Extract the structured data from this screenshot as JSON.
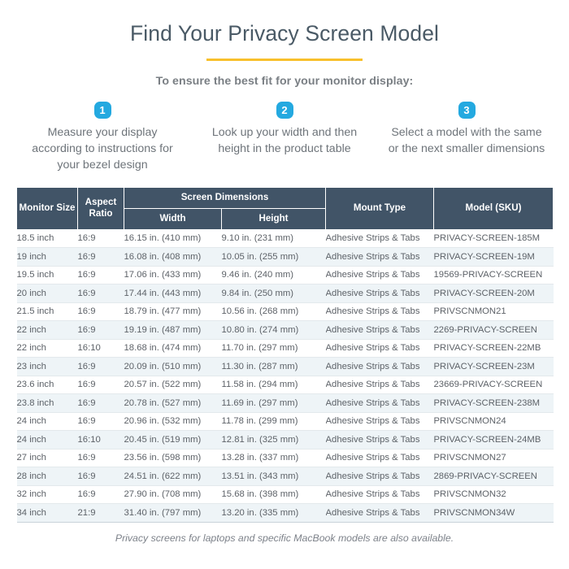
{
  "header": {
    "title": "Find Your Privacy Screen Model",
    "subtitle": "To ensure the best fit for your monitor display:",
    "accent_color": "#f8c02c",
    "title_color": "#4a5a66"
  },
  "steps": [
    {
      "number": "1",
      "text": "Measure your display according to instructions for your bezel design"
    },
    {
      "number": "2",
      "text": "Look up your width and then height in the product table"
    },
    {
      "number": "3",
      "text": "Select a model with the same or the next smaller dimensions"
    }
  ],
  "step_badge_color": "#24a9e0",
  "table": {
    "header_color": "#415467",
    "group_header": "Screen Dimensions",
    "columns": {
      "monitor_size": "Monitor Size",
      "aspect_ratio": "Aspect Ratio",
      "width": "Width",
      "height": "Height",
      "mount_type": "Mount Type",
      "model_sku": "Model (SKU)"
    },
    "rows": [
      {
        "size": "18.5 inch",
        "aspect": "16:9",
        "width": "16.15 in. (410 mm)",
        "height": "9.10 in. (231 mm)",
        "mount": "Adhesive Strips & Tabs",
        "model": "PRIVACY-SCREEN-185M"
      },
      {
        "size": "19 inch",
        "aspect": "16:9",
        "width": "16.08 in. (408 mm)",
        "height": "10.05 in. (255 mm)",
        "mount": "Adhesive Strips & Tabs",
        "model": "PRIVACY-SCREEN-19M"
      },
      {
        "size": "19.5 inch",
        "aspect": "16:9",
        "width": "17.06 in. (433 mm)",
        "height": "9.46 in. (240 mm)",
        "mount": "Adhesive Strips & Tabs",
        "model": "19569-PRIVACY-SCREEN"
      },
      {
        "size": "20 inch",
        "aspect": "16:9",
        "width": "17.44 in. (443 mm)",
        "height": "9.84 in. (250 mm)",
        "mount": "Adhesive Strips & Tabs",
        "model": "PRIVACY-SCREEN-20M"
      },
      {
        "size": "21.5 inch",
        "aspect": "16:9",
        "width": "18.79 in. (477 mm)",
        "height": "10.56 in. (268 mm)",
        "mount": "Adhesive Strips & Tabs",
        "model": "PRIVSCNMON21"
      },
      {
        "size": "22 inch",
        "aspect": "16:9",
        "width": "19.19 in. (487 mm)",
        "height": "10.80 in. (274 mm)",
        "mount": "Adhesive Strips & Tabs",
        "model": "2269-PRIVACY-SCREEN"
      },
      {
        "size": "22 inch",
        "aspect": "16:10",
        "width": "18.68 in. (474 mm)",
        "height": "11.70 in. (297 mm)",
        "mount": "Adhesive Strips & Tabs",
        "model": "PRIVACY-SCREEN-22MB"
      },
      {
        "size": "23 inch",
        "aspect": "16:9",
        "width": "20.09 in. (510 mm)",
        "height": "11.30 in. (287 mm)",
        "mount": "Adhesive Strips & Tabs",
        "model": "PRIVACY-SCREEN-23M"
      },
      {
        "size": "23.6 inch",
        "aspect": "16:9",
        "width": "20.57 in. (522 mm)",
        "height": "11.58 in. (294 mm)",
        "mount": "Adhesive Strips & Tabs",
        "model": "23669-PRIVACY-SCREEN"
      },
      {
        "size": "23.8 inch",
        "aspect": "16:9",
        "width": "20.78 in. (527 mm)",
        "height": "11.69 in. (297 mm)",
        "mount": "Adhesive Strips & Tabs",
        "model": "PRIVACY-SCREEN-238M"
      },
      {
        "size": "24 inch",
        "aspect": "16:9",
        "width": "20.96 in. (532 mm)",
        "height": "11.78 in. (299 mm)",
        "mount": "Adhesive Strips & Tabs",
        "model": "PRIVSCNMON24"
      },
      {
        "size": "24 inch",
        "aspect": "16:10",
        "width": "20.45 in. (519 mm)",
        "height": "12.81 in. (325 mm)",
        "mount": "Adhesive Strips & Tabs",
        "model": "PRIVACY-SCREEN-24MB"
      },
      {
        "size": "27 inch",
        "aspect": "16:9",
        "width": "23.56 in. (598 mm)",
        "height": "13.28 in. (337 mm)",
        "mount": "Adhesive Strips & Tabs",
        "model": "PRIVSCNMON27"
      },
      {
        "size": "28 inch",
        "aspect": "16:9",
        "width": "24.51 in. (622 mm)",
        "height": "13.51 in. (343 mm)",
        "mount": "Adhesive Strips & Tabs",
        "model": "2869-PRIVACY-SCREEN"
      },
      {
        "size": "32 inch",
        "aspect": "16:9",
        "width": "27.90 in. (708 mm)",
        "height": "15.68 in. (398 mm)",
        "mount": "Adhesive Strips & Tabs",
        "model": "PRIVSCNMON32"
      },
      {
        "size": "34 inch",
        "aspect": "21:9",
        "width": "31.40 in. (797 mm)",
        "height": "13.20 in. (335 mm)",
        "mount": "Adhesive Strips & Tabs",
        "model": "PRIVSCNMON34W"
      }
    ]
  },
  "footnote": "Privacy screens for laptops and specific MacBook models are also available."
}
